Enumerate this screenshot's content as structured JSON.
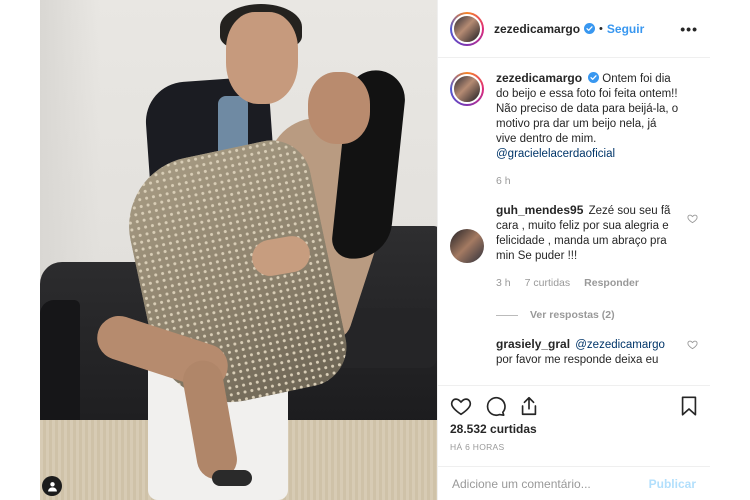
{
  "post": {
    "username": "zezedicamargo",
    "follow_label": "Seguir",
    "separator": "•",
    "more_label": "•••"
  },
  "caption": {
    "username": "zezedicamargo",
    "text": "Ontem foi dia do beijo e essa foto foi feita ontem!! Não preciso de data para beijá-la, o motivo pra dar um beijo nela, já vive dentro de mim.",
    "mention": "@gracielelacerdaoficial",
    "time": "6 h"
  },
  "comments": [
    {
      "username": "guh_mendes95",
      "text": "Zezé sou seu fã cara , muito feliz por sua alegria e felicidade , manda um abraço pra min Se puder !!!",
      "time": "3 h",
      "likes": "7 curtidas",
      "reply_label": "Responder",
      "view_replies": "Ver respostas (2)"
    },
    {
      "username": "grasiely_gral",
      "mention": "@zezedicamargo",
      "text": "por favor me responde deixa eu"
    }
  ],
  "likes_count": "28.532 curtidas",
  "posted_ago": "HÁ 6 HORAS",
  "add_comment": {
    "placeholder": "Adicione um comentário...",
    "publish_label": "Publicar"
  },
  "colors": {
    "link": "#3897f0",
    "publish_disabled": "#b2dffc",
    "meta_gray": "#999999"
  },
  "icons": {
    "verified": "verified-badge-icon",
    "like": "heart-icon",
    "comment": "comment-icon",
    "share": "share-icon",
    "save": "bookmark-icon",
    "tagged": "user-tag-icon"
  }
}
